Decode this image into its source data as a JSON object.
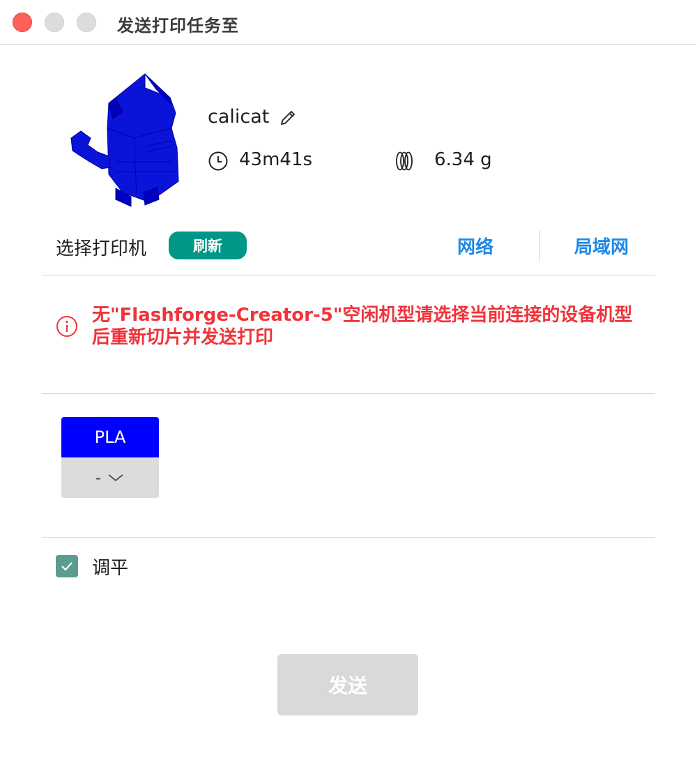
{
  "window": {
    "title": "发送打印任务至"
  },
  "model": {
    "name": "calicat",
    "print_time": "43m41s",
    "weight": "6.34 g"
  },
  "printer_select": {
    "label": "选择打印机",
    "refresh_label": "刷新",
    "tabs": [
      {
        "label": "网络"
      },
      {
        "label": "局域网"
      }
    ]
  },
  "warning": {
    "message": "无\"Flashforge-Creator-5\"空闲机型请选择当前连接的设备机型后重新切片并发送打印"
  },
  "filament": {
    "slot_label": "PLA",
    "selected_value": "-",
    "color": "#0000ff"
  },
  "leveling": {
    "label": "调平",
    "checked": true
  },
  "send": {
    "label": "发送"
  },
  "colors": {
    "accent_teal": "#009688",
    "link_blue": "#1e88e5",
    "error_red": "#f0333a",
    "checkbox_green": "#5b9b91"
  }
}
